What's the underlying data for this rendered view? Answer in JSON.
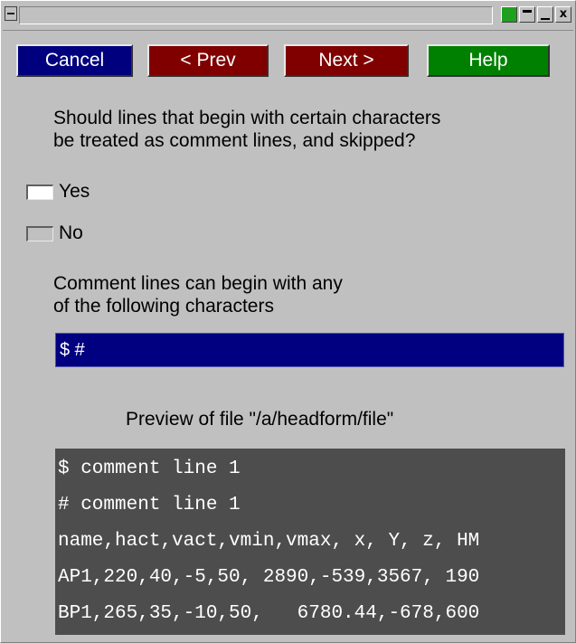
{
  "window": {
    "controls": {
      "min_icon": "minimize-icon",
      "max_icon": "maximize-icon",
      "close_glyph": "x",
      "status_color": "#20a020"
    }
  },
  "buttons": {
    "cancel": "Cancel",
    "prev": "< Prev",
    "next": "Next >",
    "help": "Help"
  },
  "question": {
    "line1": "Should lines that begin with certain characters",
    "line2": "be treated as comment lines, and skipped?"
  },
  "options": {
    "yes": {
      "label": "Yes",
      "selected": true
    },
    "no": {
      "label": "No",
      "selected": false
    }
  },
  "comment_chars": {
    "label_line1": "Comment lines can begin with any",
    "label_line2": "of the following characters",
    "value": "$ #"
  },
  "preview": {
    "title": "Preview of file \"/a/headform/file\"",
    "lines": [
      "$ comment line 1",
      "# comment line 1",
      "name,hact,vact,vmin,vmax, x, Y, z, HM",
      "AP1,220,40,-5,50, 2890,-539,3567, 190",
      "BP1,265,35,-10,50,   6780.44,-678,600"
    ]
  },
  "colors": {
    "cancel": "#00007f",
    "prev_next": "#800000",
    "help": "#008000",
    "input_bg": "#000080",
    "preview_bg": "#4d4d4d"
  }
}
